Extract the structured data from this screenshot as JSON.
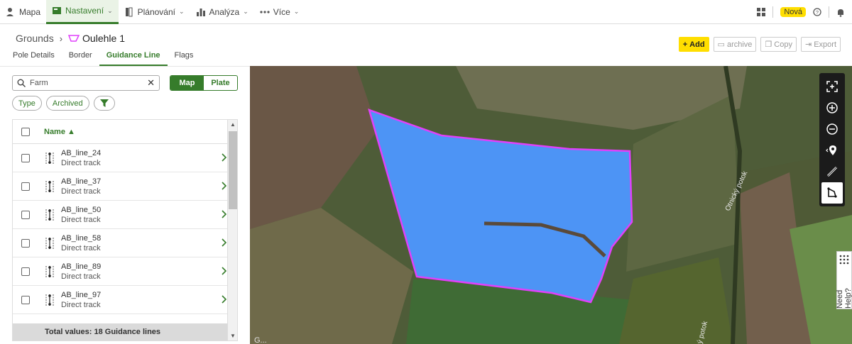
{
  "nav": {
    "items": [
      {
        "label": "Mapa",
        "icon": "person-pin-icon"
      },
      {
        "label": "Nastavení",
        "icon": "settings-panel-icon",
        "active": true
      },
      {
        "label": "Plánování",
        "icon": "book-icon"
      },
      {
        "label": "Analýza",
        "icon": "bar-chart-icon"
      },
      {
        "label": "Více",
        "icon": "dots-icon"
      }
    ],
    "badge": "Nová"
  },
  "breadcrumb": {
    "root": "Grounds",
    "current": "Oulehle 1"
  },
  "actions": {
    "add": "Add",
    "archive": "archive",
    "copy": "Copy",
    "export": "Export"
  },
  "tabs": [
    "Pole Details",
    "Border",
    "Guidance Line",
    "Flags"
  ],
  "active_tab": "Guidance Line",
  "search": {
    "value": "Farm"
  },
  "view_toggle": {
    "map": "Map",
    "plate": "Plate"
  },
  "chips": {
    "type": "Type",
    "archived": "Archived"
  },
  "list": {
    "header": "Name ▲",
    "rows": [
      {
        "name": "AB_line_24",
        "type": "Direct track"
      },
      {
        "name": "AB_line_37",
        "type": "Direct track"
      },
      {
        "name": "AB_line_50",
        "type": "Direct track"
      },
      {
        "name": "AB_line_58",
        "type": "Direct track"
      },
      {
        "name": "AB_line_89",
        "type": "Direct track"
      },
      {
        "name": "AB_line_97",
        "type": "Direct track"
      }
    ],
    "footer": "Total values: 18 Guidance lines"
  },
  "map": {
    "label_road1": "Otnický potok",
    "label_road2": "ý potok",
    "watermark": "G..."
  },
  "help": "Need Help?",
  "colors": {
    "accent": "#367c2b",
    "yellow": "#ffde00",
    "field_fill": "#4d94f5",
    "field_border": "#e040fb"
  }
}
